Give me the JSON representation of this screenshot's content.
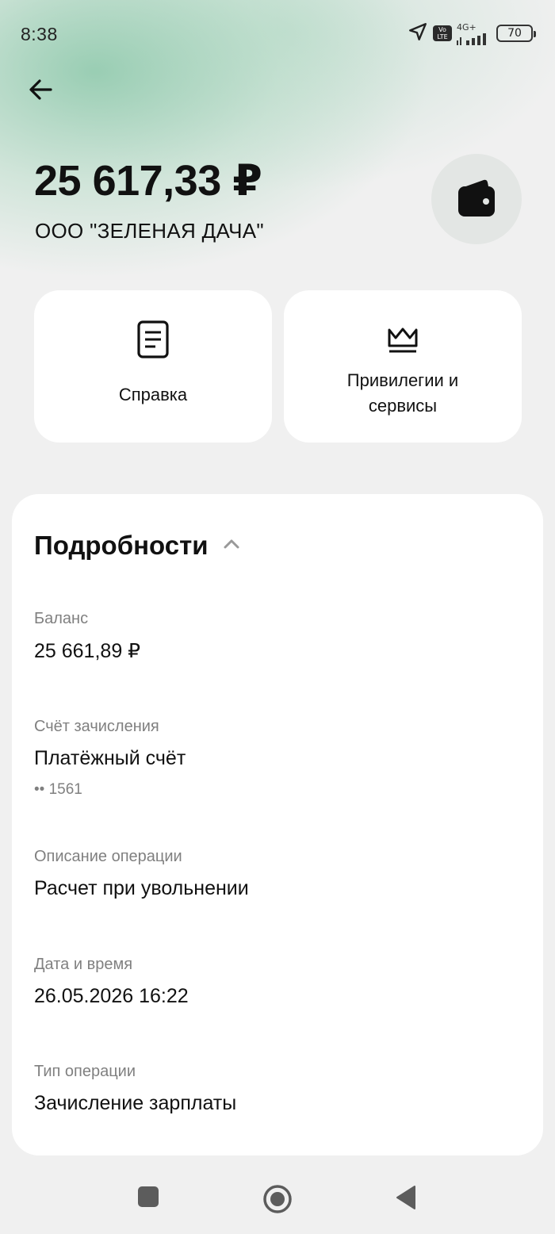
{
  "status_bar": {
    "time": "8:38",
    "network_label": "4G+",
    "volte_label": "Vo LTE",
    "battery_level": "70",
    "icons": [
      "location-arrow-icon",
      "volte-icon",
      "signal-icon",
      "battery-icon"
    ]
  },
  "header": {
    "back_icon": "arrow-left-icon",
    "amount": "25 617,33 ₽",
    "counterparty": "ООО \"ЗЕЛЕНАЯ ДАЧА\"",
    "wallet_icon": "wallet-icon"
  },
  "actions": [
    {
      "label": "Справка",
      "icon": "document-icon"
    },
    {
      "label": "Привилегии и сервисы",
      "icon": "crown-icon"
    }
  ],
  "details": {
    "title": "Подробности",
    "toggle_icon": "chevron-up-icon",
    "fields": [
      {
        "label": "Баланс",
        "value": "25 661,89 ₽"
      },
      {
        "label": "Счёт зачисления",
        "value": "Платёжный счёт",
        "sub": "•• 1561"
      },
      {
        "label": "Описание операции",
        "value": "Расчет при увольнении"
      },
      {
        "label": "Дата и время",
        "value": "26.05.2026 16:22"
      },
      {
        "label": "Тип операции",
        "value": "Зачисление зарплаты"
      }
    ]
  },
  "nav_bar": {
    "icons": [
      "recents-square-icon",
      "home-circle-icon",
      "back-triangle-icon"
    ]
  },
  "colors": {
    "background": "#f0f0f0",
    "card": "#ffffff",
    "accent_gradient": "#8cc8aa",
    "secondary_text": "#808080"
  }
}
